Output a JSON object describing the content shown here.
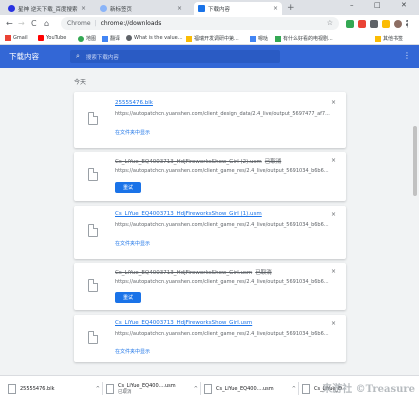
{
  "browser": {
    "tabs": [
      {
        "title": "星神 逆天下载_百度搜索",
        "icon": "baidu-paw-icon",
        "active": false
      },
      {
        "title": "新标签页",
        "icon": "chrome-newtab-icon",
        "active": false
      },
      {
        "title": "下载内容",
        "icon": "download-tab-icon",
        "active": true
      }
    ],
    "tab_close_glyph": "×",
    "new_tab_glyph": "+",
    "window_controls": {
      "minimize": "–",
      "maximize": "□",
      "close": "✕"
    },
    "nav": {
      "back": "←",
      "forward": "→",
      "reload": "C",
      "home": "⌂"
    },
    "omnibox": {
      "chip": "Chrome",
      "separator": "|",
      "url": "chrome://downloads",
      "star": "☆"
    },
    "bookmarks": [
      {
        "label": "Gmail",
        "icon": "gmail-icon",
        "color": "#ea4335"
      },
      {
        "label": "YouTube",
        "icon": "youtube-icon",
        "color": "#ff0000"
      },
      {
        "label": "地图",
        "icon": "maps-icon",
        "color": "#34a853"
      },
      {
        "label": "翻译",
        "icon": "translate-icon",
        "color": "#4285f4"
      },
      {
        "label": "What is the value...",
        "icon": "globe-icon",
        "color": "#5f6368"
      },
      {
        "label": "福瑞开发调研中第...",
        "icon": "bookmark-icon",
        "color": "#fbbc04"
      },
      {
        "label": "嗯哒",
        "icon": "bookmark-icon",
        "color": "#4285f4"
      },
      {
        "label": "有什么好看的电视剧...",
        "icon": "bookmark-icon",
        "color": "#34a853"
      },
      {
        "label": "其他书签",
        "icon": "folder-icon",
        "color": "#fbbc04"
      }
    ]
  },
  "downloads": {
    "header_title": "下载内容",
    "search_placeholder": "搜索下载内容",
    "search_icon": "⌕",
    "more_glyph": "⋮",
    "date_label": "今天",
    "close_glyph": "×",
    "items": [
      {
        "name": "25555476.blk",
        "status": "",
        "url": "https://autopatchcn.yuanshen.com/client_design_data/2.4_live/output_5697477_af7...",
        "state": "complete",
        "link_label": "在文件夹中显示",
        "button_label": ""
      },
      {
        "name": "Cs_LiYue_EQ4003713_HdjFireworksShow_Girl (2).usm",
        "status": "已取消",
        "url": "https://autopatchcn.yuanshen.com/client_game_res/2.4_live/output_5691034_b6b6...",
        "state": "cancelled",
        "link_label": "",
        "button_label": "重试"
      },
      {
        "name": "Cs_LiYue_EQ4003713_HdjFireworksShow_Girl (1).usm",
        "status": "",
        "url": "https://autopatchcn.yuanshen.com/client_game_res/2.4_live/output_5691034_b6b6...",
        "state": "complete",
        "link_label": "在文件夹中显示",
        "button_label": ""
      },
      {
        "name": "Cs_LiYue_EQ4003713_HdjFireworksShow_Girl.usm",
        "status": "已取消",
        "url": "https://autopatchcn.yuanshen.com/client_game_res/2.4_live/output_5691034_b6b6...",
        "state": "cancelled",
        "link_label": "",
        "button_label": "重试"
      },
      {
        "name": "Cs_LiYue_EQ4003713_HdjFireworksShow_Girl.usm",
        "status": "",
        "url": "https://autopatchcn.yuanshen.com/client_game_res/2.4_live/output_5691034_b6b6...",
        "state": "complete",
        "link_label": "在文件夹中显示",
        "button_label": ""
      }
    ]
  },
  "shelf": {
    "items": [
      {
        "name": "25555476.blk",
        "status": ""
      },
      {
        "name": "Cs_LiYue_EQ400....usm",
        "status": "已取消"
      },
      {
        "name": "Cs_LiYue_EQ400....usm",
        "status": ""
      },
      {
        "name": "Cs_LiYue_EQ400....usm",
        "status": ""
      }
    ],
    "caret_glyph": "^",
    "watermark": "来游社 ©Treasure"
  }
}
